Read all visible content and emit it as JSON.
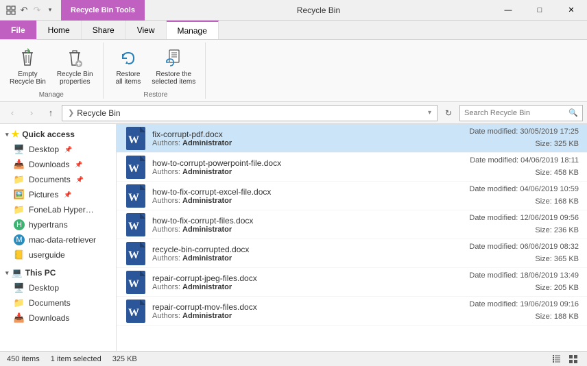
{
  "titlebar": {
    "ribbon_context_title": "Recycle Bin Tools",
    "window_title": "Recycle Bin",
    "minimize": "—",
    "maximize": "□",
    "close": "✕"
  },
  "ribbon": {
    "tabs": [
      "File",
      "Home",
      "Share",
      "View",
      "Manage"
    ],
    "active_tab": "Manage",
    "groups": [
      {
        "label": "Manage",
        "buttons": [
          {
            "label": "Empty\nRecycle Bin",
            "icon": "recycle-empty"
          },
          {
            "label": "Recycle Bin\nproperties",
            "icon": "recycle-props"
          }
        ]
      },
      {
        "label": "Restore",
        "buttons": [
          {
            "label": "Restore\nall items",
            "icon": "restore-all"
          },
          {
            "label": "Restore the\nselected items",
            "icon": "restore-selected"
          }
        ]
      }
    ]
  },
  "toolbar": {
    "back": "‹",
    "forward": "›",
    "up": "↑",
    "breadcrumb_icon": "❯",
    "address": "Recycle Bin",
    "search_placeholder": "Search Recycle Bin",
    "refresh_icon": "↻"
  },
  "sidebar": {
    "sections": [
      {
        "label": "Quick access",
        "icon": "⭐",
        "items": [
          {
            "label": "Desktop",
            "icon": "🖥️",
            "pinned": true
          },
          {
            "label": "Downloads",
            "icon": "📥",
            "pinned": true
          },
          {
            "label": "Documents",
            "icon": "📁",
            "pinned": true
          },
          {
            "label": "Pictures",
            "icon": "🖼️",
            "pinned": true
          },
          {
            "label": "FoneLab HyperTrans...",
            "icon": "📁"
          },
          {
            "label": "hypertrans",
            "icon": "📁"
          },
          {
            "label": "mac-data-retriever",
            "icon": "📁"
          },
          {
            "label": "userguide",
            "icon": "📁"
          }
        ]
      },
      {
        "label": "This PC",
        "icon": "💻",
        "items": [
          {
            "label": "Desktop",
            "icon": "🖥️"
          },
          {
            "label": "Documents",
            "icon": "📁"
          },
          {
            "label": "Downloads",
            "icon": "📥"
          }
        ]
      }
    ]
  },
  "files": [
    {
      "name": "fix-corrupt-pdf.docx",
      "author": "Administrator",
      "date_modified": "Date modified: 30/05/2019 17:25",
      "size": "Size: 325 KB",
      "selected": true
    },
    {
      "name": "how-to-corrupt-powerpoint-file.docx",
      "author": "Administrator",
      "date_modified": "Date modified: 04/06/2019 18:11",
      "size": "Size: 458 KB",
      "selected": false
    },
    {
      "name": "how-to-fix-corrupt-excel-file.docx",
      "author": "Administrator",
      "date_modified": "Date modified: 04/06/2019 10:59",
      "size": "Size: 168 KB",
      "selected": false
    },
    {
      "name": "how-to-fix-corrupt-files.docx",
      "author": "Administrator",
      "date_modified": "Date modified: 12/06/2019 09:56",
      "size": "Size: 236 KB",
      "selected": false
    },
    {
      "name": "recycle-bin-corrupted.docx",
      "author": "Administrator",
      "date_modified": "Date modified: 06/06/2019 08:32",
      "size": "Size: 365 KB",
      "selected": false
    },
    {
      "name": "repair-corrupt-jpeg-files.docx",
      "author": "Administrator",
      "date_modified": "Date modified: 18/06/2019 13:49",
      "size": "Size: 205 KB",
      "selected": false
    },
    {
      "name": "repair-corrupt-mov-files.docx",
      "author": "Administrator",
      "date_modified": "Date modified: 19/06/2019 09:16",
      "size": "Size: 188 KB",
      "selected": false
    }
  ],
  "statusbar": {
    "count": "450 items",
    "selected": "1 item selected",
    "size": "325 KB"
  },
  "authors_label": "Authors:"
}
